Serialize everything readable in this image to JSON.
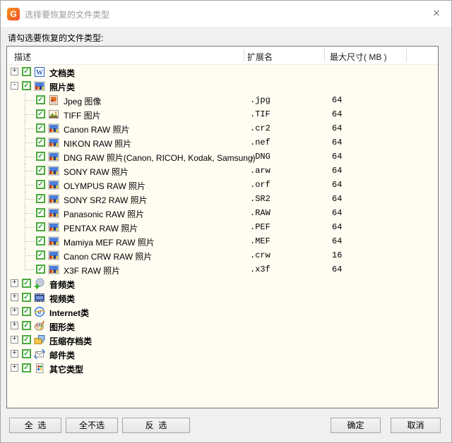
{
  "window": {
    "title": "选择要恢复的文件类型",
    "logo_glyph": "G",
    "close_glyph": "×"
  },
  "prompt": "请勾选要恢复的文件类型:",
  "icons": {
    "check": "✓"
  },
  "colors": {
    "accent_orange": "#f26522",
    "checkbox_green": "#4aa93c",
    "list_background": "#fffdf2",
    "title_text": "#9a9a9a"
  },
  "table": {
    "columns": [
      {
        "label": "描述"
      },
      {
        "label": "扩展名"
      },
      {
        "label": "最大尺寸( MB )"
      }
    ],
    "rows": [
      {
        "level": 0,
        "expand": "+",
        "checked": true,
        "icon": "word-doc-icon",
        "label": "文档类",
        "ext": "",
        "size": ""
      },
      {
        "level": 0,
        "expand": "-",
        "checked": true,
        "icon": "photo-category-icon",
        "label": "照片类",
        "ext": "",
        "size": ""
      },
      {
        "level": 1,
        "checked": true,
        "icon": "jpeg-image-icon",
        "label": "Jpeg 图像",
        "ext": ".jpg",
        "size": "64"
      },
      {
        "level": 1,
        "checked": true,
        "icon": "tiff-image-icon",
        "label": "TIFF 图片",
        "ext": ".TIF",
        "size": "64"
      },
      {
        "level": 1,
        "checked": true,
        "icon": "raw-photo-icon",
        "label": "Canon RAW 照片",
        "ext": ".cr2",
        "size": "64"
      },
      {
        "level": 1,
        "checked": true,
        "icon": "raw-photo-icon",
        "label": "NIKON RAW 照片",
        "ext": ".nef",
        "size": "64"
      },
      {
        "level": 1,
        "checked": true,
        "icon": "raw-photo-icon",
        "label": "DNG RAW 照片(Canon, RICOH, Kodak, Samsung)",
        "ext": ".DNG",
        "size": "64"
      },
      {
        "level": 1,
        "checked": true,
        "icon": "raw-photo-icon",
        "label": "SONY RAW 照片",
        "ext": ".arw",
        "size": "64"
      },
      {
        "level": 1,
        "checked": true,
        "icon": "raw-photo-icon",
        "label": "OLYMPUS RAW 照片",
        "ext": ".orf",
        "size": "64"
      },
      {
        "level": 1,
        "checked": true,
        "icon": "raw-photo-icon",
        "label": "SONY SR2 RAW 照片",
        "ext": ".SR2",
        "size": "64"
      },
      {
        "level": 1,
        "checked": true,
        "icon": "raw-photo-icon",
        "label": "Panasonic RAW 照片",
        "ext": ".RAW",
        "size": "64"
      },
      {
        "level": 1,
        "checked": true,
        "icon": "raw-photo-icon",
        "label": "PENTAX RAW 照片",
        "ext": ".PEF",
        "size": "64"
      },
      {
        "level": 1,
        "checked": true,
        "icon": "raw-photo-icon",
        "label": "Mamiya MEF RAW 照片",
        "ext": ".MEF",
        "size": "64"
      },
      {
        "level": 1,
        "checked": true,
        "icon": "raw-photo-icon",
        "label": "Canon CRW RAW 照片",
        "ext": ".crw",
        "size": "16"
      },
      {
        "level": 1,
        "checked": true,
        "icon": "raw-photo-icon",
        "label": "X3F RAW 照片",
        "ext": ".x3f",
        "size": "64",
        "last": true
      },
      {
        "level": 0,
        "expand": "+",
        "checked": true,
        "icon": "audio-icon",
        "label": "音频类",
        "ext": "",
        "size": ""
      },
      {
        "level": 0,
        "expand": "+",
        "checked": true,
        "icon": "video-icon",
        "label": "视频类",
        "ext": "",
        "size": ""
      },
      {
        "level": 0,
        "expand": "+",
        "checked": true,
        "icon": "internet-icon",
        "label": "Internet类",
        "ext": "",
        "size": ""
      },
      {
        "level": 0,
        "expand": "+",
        "checked": true,
        "icon": "graphics-icon",
        "label": "图形类",
        "ext": "",
        "size": ""
      },
      {
        "level": 0,
        "expand": "+",
        "checked": true,
        "icon": "archive-icon",
        "label": "压缩存档类",
        "ext": "",
        "size": ""
      },
      {
        "level": 0,
        "expand": "+",
        "checked": true,
        "icon": "mail-icon",
        "label": "邮件类",
        "ext": "",
        "size": ""
      },
      {
        "level": 0,
        "expand": "+",
        "checked": true,
        "icon": "other-icon",
        "label": "其它类型",
        "ext": "",
        "size": ""
      }
    ]
  },
  "footer": {
    "select_all": "全  选",
    "select_none": "全不选",
    "invert": "反  选",
    "ok": "确定",
    "cancel": "取消"
  }
}
